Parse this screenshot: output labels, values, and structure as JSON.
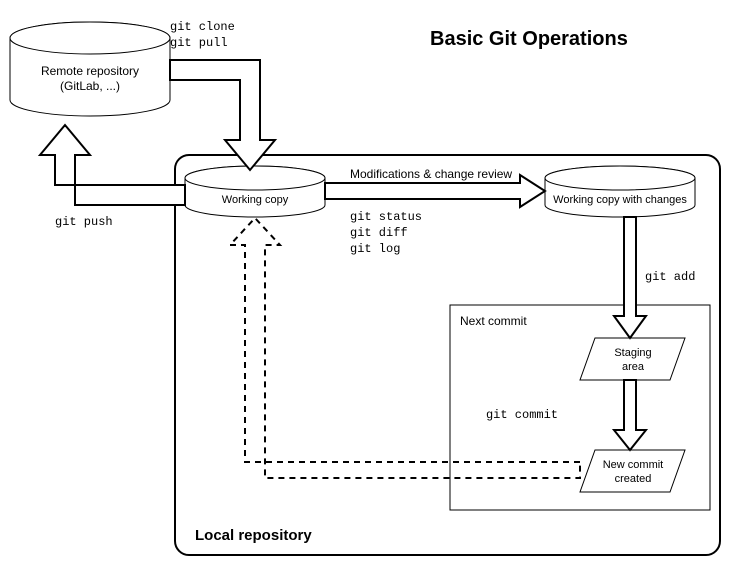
{
  "title": "Basic Git Operations",
  "nodes": {
    "remote": {
      "label1": "Remote repository",
      "label2": "(GitLab, ...)"
    },
    "working": {
      "label": "Working copy"
    },
    "changes": {
      "label": "Working copy with changes"
    },
    "staging": {
      "label1": "Staging",
      "label2": "area"
    },
    "commit": {
      "label1": "New commit",
      "label2": "created"
    }
  },
  "containers": {
    "local": {
      "label": "Local repository"
    },
    "next": {
      "label": "Next commit"
    }
  },
  "edges": {
    "remote_to_working": {
      "label1": "git clone",
      "label2": "git pull"
    },
    "working_to_remote": {
      "label": "git push"
    },
    "working_to_changes": {
      "top": "Modifications & change review",
      "cmd1": "git status",
      "cmd2": "git diff",
      "cmd3": "git log"
    },
    "changes_to_staging": {
      "label": "git add"
    },
    "staging_to_commit": {
      "label": "git commit"
    },
    "commit_to_working": {
      "label": ""
    }
  }
}
